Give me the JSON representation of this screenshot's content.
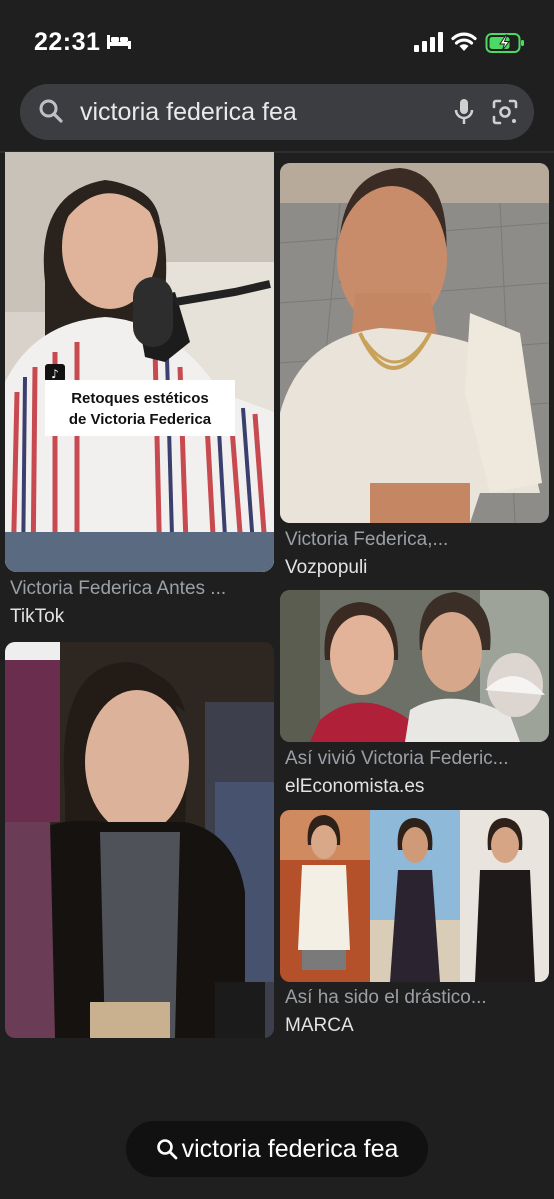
{
  "status_bar": {
    "time": "22:31"
  },
  "search": {
    "query": "victoria federica fea"
  },
  "results": [
    {
      "title": "Victoria Federica Antes ...",
      "source": "TikTok",
      "overlay": "Retoques estéticos de Victoria Federica",
      "overlay_line1": "Retoques estéticos",
      "overlay_line2": "de Victoria Federica"
    },
    {
      "title": "Victoria Federica,...",
      "source": "Vozpopuli"
    },
    {
      "title": "Así vivió Victoria Federic...",
      "source": "elEconomista.es"
    },
    {
      "title": "Así ha sido el drástico...",
      "source": "MARCA"
    },
    {
      "title": "",
      "source": ""
    }
  ],
  "bottom_pill": {
    "query": "victoria federica fea"
  },
  "colors": {
    "background": "#1f1f1f",
    "search_bar": "#3c3d40",
    "caption": "#9aa0a6",
    "battery": "#4cd964"
  }
}
